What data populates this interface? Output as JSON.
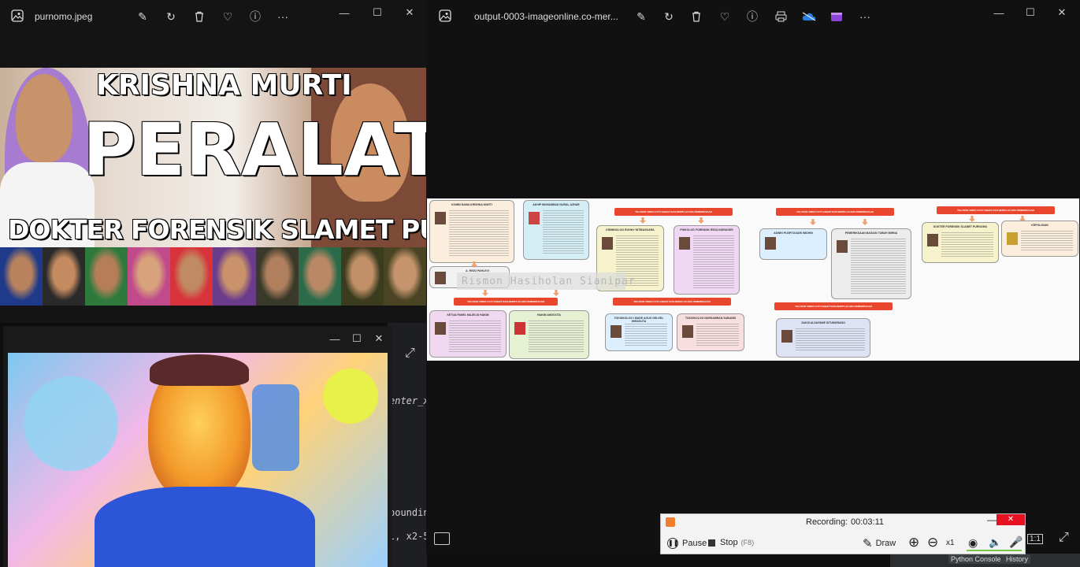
{
  "left_window": {
    "filename": "purnomo.jpeg",
    "poster": {
      "line1": "KRISHNA MURTI",
      "line2": "PERALAT",
      "line3": "DOKTER FORENSIK SLAMET PURNOMO"
    }
  },
  "right_window": {
    "filename": "output-0003-imageonline.co-mer...",
    "watermark": "Rismon Hasiholan Sianipar",
    "mindmap": {
      "box_titles": [
        "KOMBI NAMA KRISHNA MURTI",
        "AKHIP MUHAMMAD NURAL AZHAR",
        "KRIMINOLOG RONNY NITIBASKARA",
        "PSIKOLOG FORENSIK REZA INDRAGIRI",
        "ASWIN PUSPITASARI WIDHIN",
        "PEMERIKSAAN BAGIAN TUBUH MIRNA",
        "DOKTER FORENSIK SLAMET PURNOMO",
        "KEPOLISIAN",
        "A. RISKI PAHLEVI",
        "KETUA PANEL MAJELIS HAKIM",
        "HAKIM ANGGOTA",
        "TOKSIKOLOG I MADE AGUS GELGEL WIRASUTA",
        "TOKSIKOLOG NURSAMRAN SUBANDI",
        "SAKSI ALDAPANE SITUMORANG"
      ],
      "red_labels": [
        "TELUSUR VIDEO CCTV HEBAT DAN BERITA ACARA PEMERIKSAAN",
        "TELUSUR VIDEO CCTV HEBAT DAN BERITA ACARA PEMERIKSAAN",
        "TELUSUR VIDEO CCTV HEBAT DAN BERITA ACARA PEMERIKSAAN",
        "TELUSUR VIDEO CCTV HEBAT DAN BERITA ACARA PEMERIKSAAN",
        "TELUSUR VIDEO CCTV HEBAT DAN BERITA ACARA PEMERIKSAAN",
        "TELUSUR VIDEO CCTV HEBAT DAN BERITA ACARA PEMERIKSAAN"
      ]
    }
  },
  "code_editor": {
    "fragments": [
      "enter_x",
      "boundin",
      "l, x2-5"
    ],
    "status_tabs": [
      "Python Console",
      "History"
    ]
  },
  "recorder": {
    "title": "Recording:",
    "time": "00:03:11",
    "pause_label": "Pause",
    "stop_label": "Stop",
    "stop_shortcut": "(F8)",
    "draw_label": "Draw",
    "zoom_level": "x1",
    "ratio_label": "1:1"
  },
  "colors": {
    "rec_red": "#e8472e",
    "close_red": "#e81123",
    "poster_bg": "#5a3a2e",
    "mindmap_bg": "#fafafa"
  }
}
